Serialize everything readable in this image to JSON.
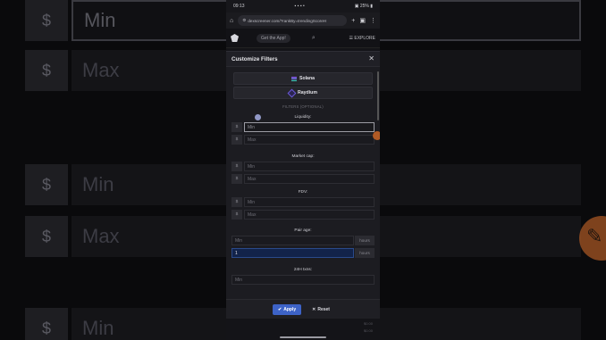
{
  "background": {
    "rows": [
      {
        "dollar": "$",
        "field": "Min"
      },
      {
        "dollar": "$",
        "field": "Max"
      },
      {
        "dollar": "$",
        "field": "Min"
      },
      {
        "dollar": "$",
        "field": "Max"
      },
      {
        "dollar": "$",
        "field": "Min"
      }
    ]
  },
  "statusbar": {
    "time": "09:13",
    "icons": "▪ ▪ ▪ •",
    "right": "▣ 25% ▮"
  },
  "browser": {
    "url": "dexscreener.com/?rankBy=trendingScoreH",
    "home_icon": "⌂",
    "settings_icon": "⚙",
    "add_tab": "+",
    "tabs_icon": "▣",
    "menu_icon": "⋮"
  },
  "topnav": {
    "get_app": "Get the App!",
    "search_icon": "⌕",
    "explore": "EXPLORE",
    "menu_icon": "☰"
  },
  "modal": {
    "title": "Customize Filters",
    "close": "✕",
    "chains": [
      {
        "label": "Solana"
      },
      {
        "label": "Raydium"
      }
    ],
    "filters_caption": "FILTERS (OPTIONAL)",
    "liquidity": {
      "label": "Liquidity:",
      "dollar": "$",
      "min": "Min",
      "max": "Max"
    },
    "market_cap": {
      "label": "Market cap:",
      "dollar": "$",
      "min": "Min",
      "max": "Max"
    },
    "fdv": {
      "label": "FDV:",
      "dollar": "$",
      "min": "Min",
      "max": "Max"
    },
    "pair_age": {
      "label": "Pair age:",
      "min": "Min",
      "min_unit": "hours",
      "max_value": "1",
      "max_unit": "hours"
    },
    "txns_24h": {
      "label": "24H txns:",
      "min": "Min"
    }
  },
  "footer": {
    "apply": "Apply",
    "apply_icon": "✔",
    "reset": "Reset",
    "reset_icon": "✕",
    "peek": [
      "$0.00",
      "$0.00"
    ]
  },
  "colors": {
    "accent": "#3d63c7",
    "modal_bg": "#1c1c21",
    "page_bg": "#0a0a0c"
  }
}
